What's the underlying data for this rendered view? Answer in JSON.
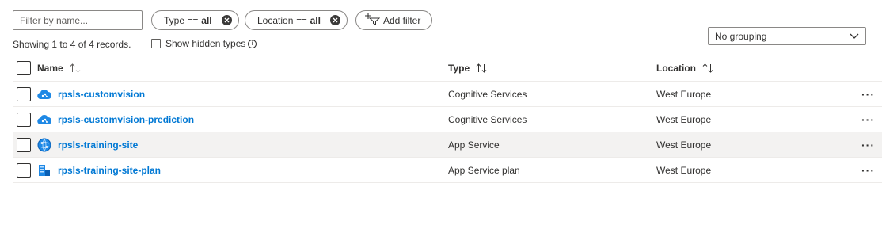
{
  "filter": {
    "placeholder": "Filter by name..."
  },
  "pills": [
    {
      "label": "Type",
      "operator": "==",
      "value": "all"
    },
    {
      "label": "Location",
      "operator": "==",
      "value": "all"
    }
  ],
  "add_filter": {
    "label": "Add filter",
    "icon": "add-filter-icon"
  },
  "summary": {
    "text": "Showing 1 to 4 of 4 records."
  },
  "show_hidden": {
    "label": "Show hidden types",
    "checked": false
  },
  "grouping": {
    "selected": "No grouping"
  },
  "table": {
    "columns": {
      "name": "Name",
      "type": "Type",
      "location": "Location"
    },
    "rows": [
      {
        "name": "rpsls-customvision",
        "type": "Cognitive Services",
        "location": "West Europe",
        "icon": "cognitive-services-icon",
        "selected": false
      },
      {
        "name": "rpsls-customvision-prediction",
        "type": "Cognitive Services",
        "location": "West Europe",
        "icon": "cognitive-services-icon",
        "selected": false
      },
      {
        "name": "rpsls-training-site",
        "type": "App Service",
        "location": "West Europe",
        "icon": "app-service-icon",
        "selected": true
      },
      {
        "name": "rpsls-training-site-plan",
        "type": "App Service plan",
        "location": "West Europe",
        "icon": "app-service-plan-icon",
        "selected": false
      }
    ]
  },
  "colors": {
    "link": "#0078d4",
    "border": "#8a8886",
    "row_highlight": "#f3f2f1",
    "icon_blue": "#1e88e5"
  }
}
